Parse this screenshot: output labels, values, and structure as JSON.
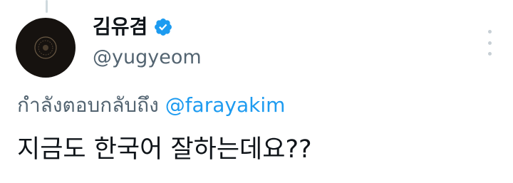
{
  "tweet": {
    "author": {
      "display_name": "김유겸",
      "handle": "@yugyeom",
      "verified": true,
      "avatar_icon": "profile-avatar-dark-emblem"
    },
    "reply_context": {
      "prefix": "กำลังตอบกลับถึง",
      "handle": "@farayakim"
    },
    "text": "지금도 한국어 잘하는데요??",
    "menu_icon": "more-vertical-icon"
  },
  "colors": {
    "text_primary": "#0f1419",
    "text_secondary": "#536471",
    "accent": "#1d9bf0",
    "verified_badge": "#1d9bf0",
    "avatar_bg": "#16120f"
  }
}
